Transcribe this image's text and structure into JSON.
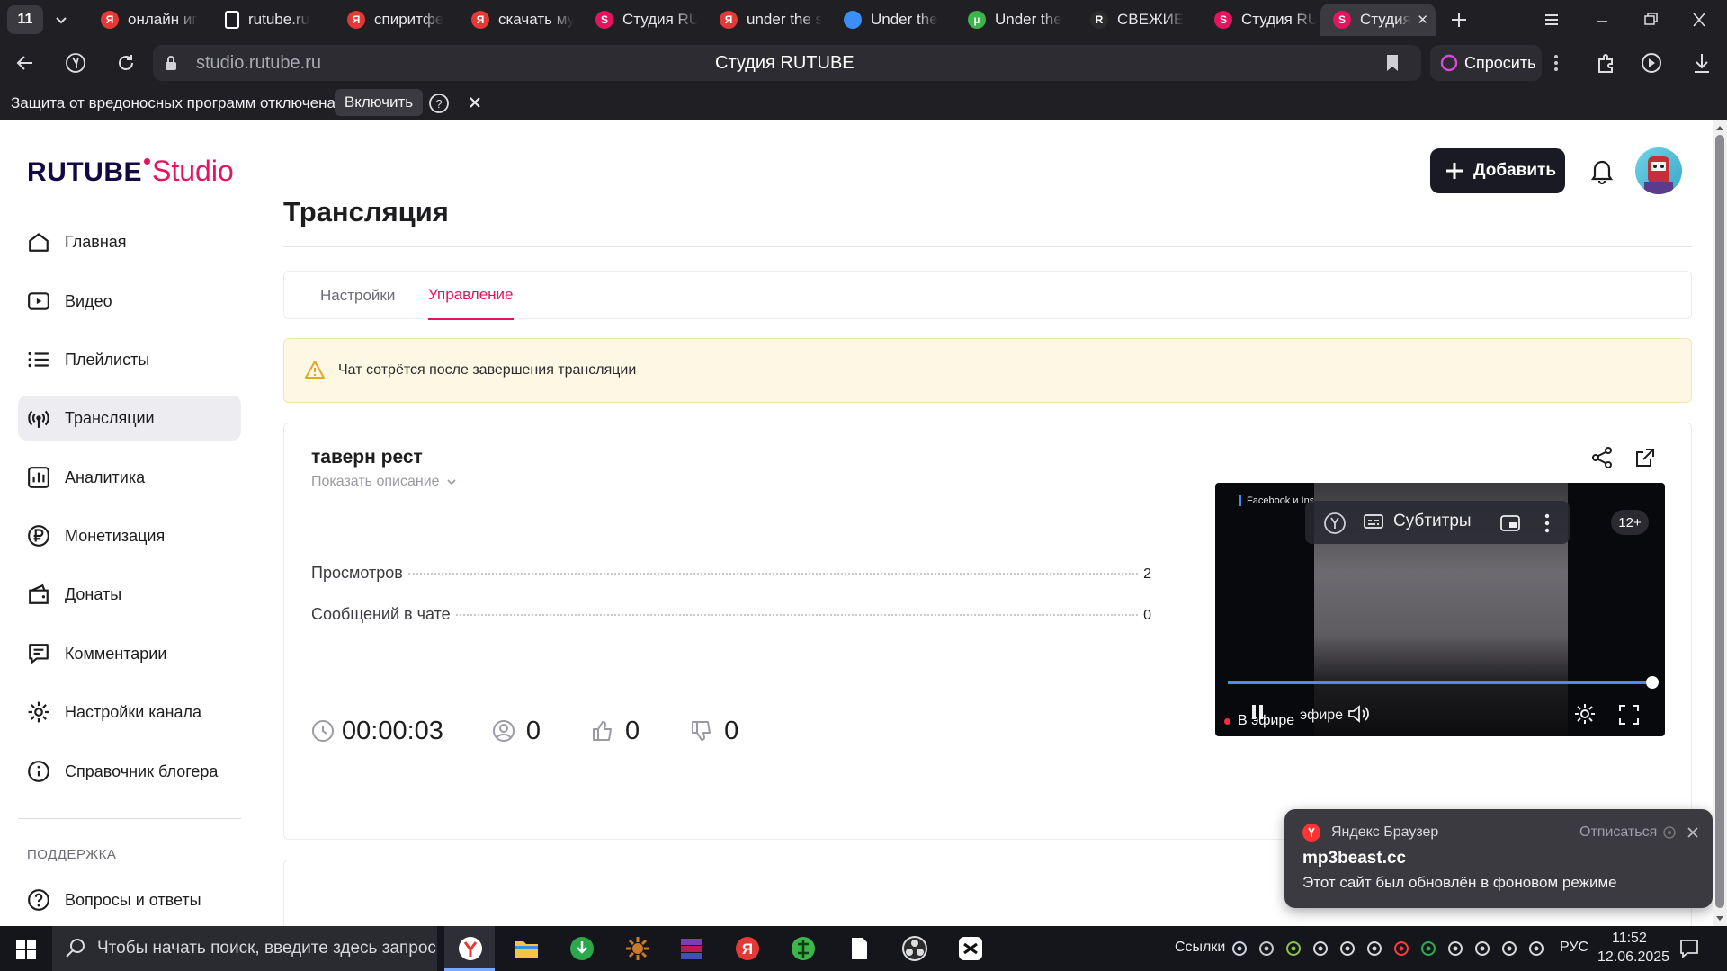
{
  "browser": {
    "tab_count": "11",
    "tabs": [
      {
        "title": "онлайн иг",
        "icon_color": "#e53935",
        "icon": "yandex-icon"
      },
      {
        "title": "rutube.ru",
        "icon_color": "#ffffff",
        "icon": "document-icon"
      },
      {
        "title": "спиритфе",
        "icon_color": "#e53935",
        "icon": "yandex-icon"
      },
      {
        "title": "скачать му",
        "icon_color": "#e53935",
        "icon": "yandex-icon"
      },
      {
        "title": "Студия RU",
        "icon_color": "#e4145f",
        "icon": "studio-icon"
      },
      {
        "title": "under the s",
        "icon_color": "#e53935",
        "icon": "yandex-icon"
      },
      {
        "title": "Under the",
        "icon_color": "#3a8ef6",
        "icon": "game-icon"
      },
      {
        "title": "Under the",
        "icon_color": "#3cb54a",
        "icon": "torrent-icon"
      },
      {
        "title": "СВЕЖИЕ",
        "icon_color": "#2b2b2b",
        "icon": "r-icon"
      },
      {
        "title": "Студия RU",
        "icon_color": "#e4145f",
        "icon": "studio-icon"
      },
      {
        "title": "Студия",
        "icon_color": "#e4145f",
        "icon": "studio-icon"
      }
    ],
    "address": "studio.rutube.ru",
    "page_title": "Студия RUTUBE",
    "ask_label": "Спросить",
    "infobar_text": "Защита от вредоносных программ отключена",
    "infobar_button": "Включить"
  },
  "app": {
    "logo_main": "RUTUBE",
    "logo_sub": "Studio",
    "add_button": "Добавить",
    "sidebar": [
      {
        "label": "Главная",
        "icon": "home-icon"
      },
      {
        "label": "Видео",
        "icon": "video-icon"
      },
      {
        "label": "Плейлисты",
        "icon": "playlist-icon"
      },
      {
        "label": "Трансляции",
        "icon": "broadcast-icon"
      },
      {
        "label": "Аналитика",
        "icon": "analytics-icon"
      },
      {
        "label": "Монетизация",
        "icon": "ruble-icon"
      },
      {
        "label": "Донаты",
        "icon": "wallet-icon"
      },
      {
        "label": "Комментарии",
        "icon": "comment-icon"
      },
      {
        "label": "Настройки канала",
        "icon": "gear-icon"
      },
      {
        "label": "Справочник блогера",
        "icon": "info-icon"
      }
    ],
    "support_heading": "ПОДДЕРЖКА",
    "support_items": [
      {
        "label": "Вопросы и ответы",
        "icon": "help-icon"
      }
    ],
    "page_title": "Трансляция",
    "tabs": [
      "Настройки",
      "Управление"
    ],
    "warning": "Чат сотрётся после завершения трансляции",
    "stream": {
      "title": "таверн рест",
      "show_description": "Показать описание",
      "stats": [
        {
          "label": "Просмотров",
          "value": "2"
        },
        {
          "label": "Сообщений в чате",
          "value": "0"
        }
      ],
      "duration": "00:00:03",
      "viewers": "0",
      "likes": "0",
      "dislikes": "0"
    },
    "player": {
      "overlay_text": "Facebook и Ins",
      "subtitles_label": "Субтитры",
      "age_badge": "12+",
      "live_label": "В эфире",
      "live_label_behind": "эфире",
      "progress": 1.0
    },
    "notification": {
      "source": "Яндекс Браузер",
      "unsubscribe": "Отписаться",
      "title": "mp3beast.cc",
      "body": "Этот сайт был обновлён в фоновом режиме"
    }
  },
  "taskbar": {
    "search_placeholder": "Чтобы начать поиск, введите здесь запрос",
    "links_label": "Ссылки",
    "language": "РУС",
    "time": "11:52",
    "date": "12.06.2025"
  },
  "colors": {
    "accent": "#e4145f",
    "brand_blue": "#100943",
    "warning_bg": "#fdf7e4",
    "warning_border": "#f5e3b0"
  }
}
